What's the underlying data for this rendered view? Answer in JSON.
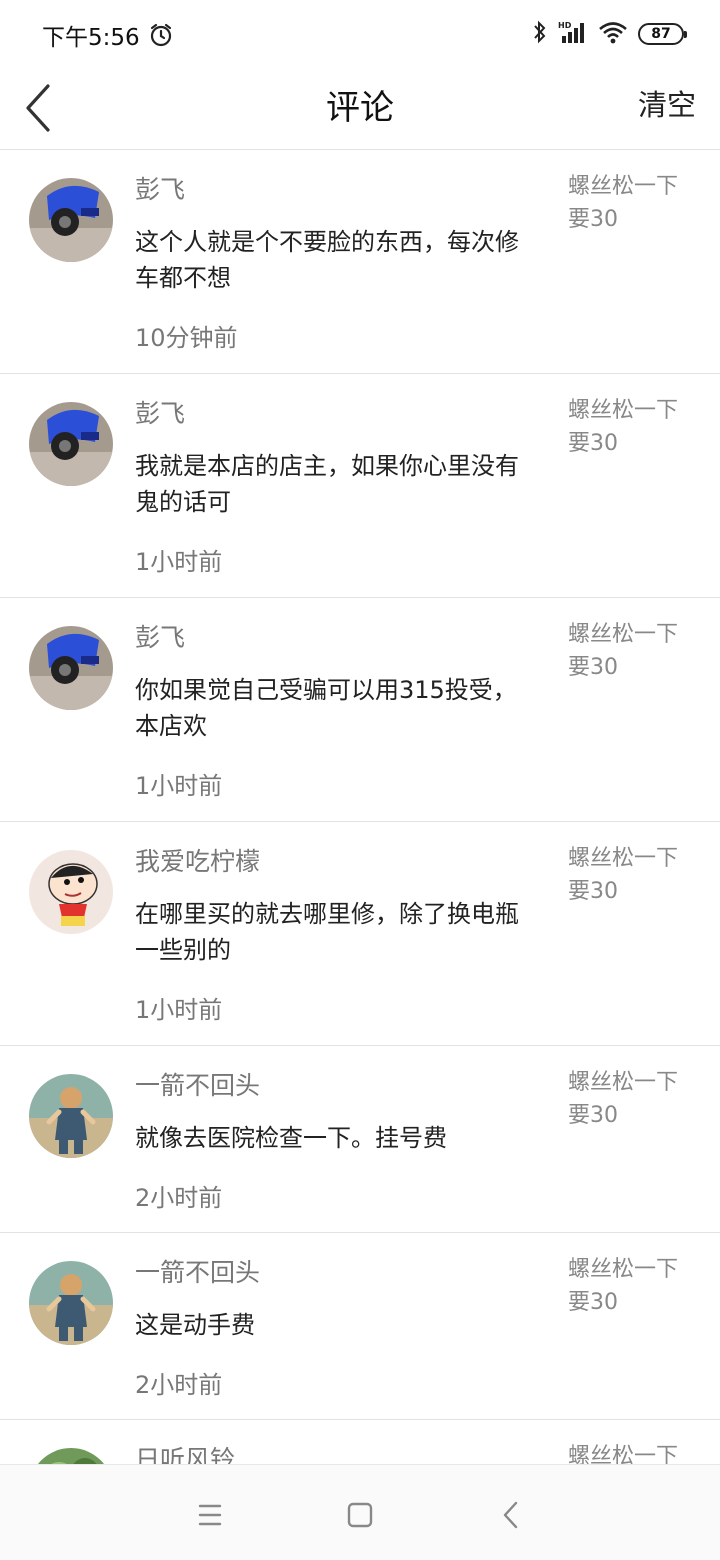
{
  "status_bar": {
    "time": "下午5:56",
    "battery": "87",
    "icons": [
      "alarm-icon",
      "bluetooth-icon",
      "hd-signal-icon",
      "wifi-icon",
      "battery-icon"
    ]
  },
  "header": {
    "title": "评论",
    "clear_label": "清空",
    "back_icon": "back-chevron-icon"
  },
  "comments": [
    {
      "author": "彭飞",
      "content": "这个人就是个不要脸的东西，每次修车都不想",
      "time": "10分钟前",
      "quote": "螺丝松一下要30",
      "avatar": "motorcycle"
    },
    {
      "author": "彭飞",
      "content": "我就是本店的店主，如果你心里没有鬼的话可",
      "time": "1小时前",
      "quote": "螺丝松一下要30",
      "avatar": "motorcycle"
    },
    {
      "author": "彭飞",
      "content": "你如果觉自己受骗可以用315投受，本店欢",
      "time": "1小时前",
      "quote": "螺丝松一下要30",
      "avatar": "motorcycle"
    },
    {
      "author": "我爱吃柠檬",
      "content": "在哪里买的就去哪里修，除了换电瓶一些别的",
      "time": "1小时前",
      "quote": "螺丝松一下要30",
      "avatar": "cartoon"
    },
    {
      "author": "一箭不回头",
      "content": "就像去医院检查一下。挂号费",
      "time": "2小时前",
      "quote": "螺丝松一下要30",
      "avatar": "child"
    },
    {
      "author": "一箭不回头",
      "content": "这是动手费",
      "time": "2小时前",
      "quote": "螺丝松一下要30",
      "avatar": "child"
    },
    {
      "author": "日听风铃",
      "content": "",
      "time": "",
      "quote": "螺丝松一下",
      "avatar": "plant"
    }
  ],
  "nav_bar": {
    "icons": [
      "menu-icon",
      "home-icon",
      "back-icon"
    ]
  },
  "colors": {
    "divider": "#e2e2e2",
    "secondary_text": "#777777"
  }
}
